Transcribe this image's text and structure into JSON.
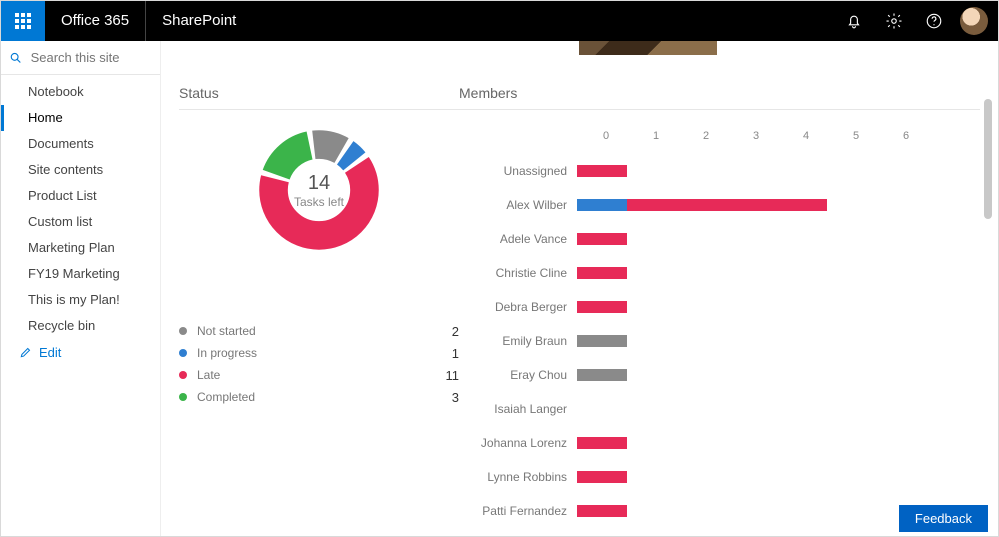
{
  "header": {
    "brand": "Office 365",
    "app": "SharePoint"
  },
  "search": {
    "placeholder": "Search this site"
  },
  "nav": {
    "items": [
      {
        "label": "Notebook",
        "selected": false
      },
      {
        "label": "Home",
        "selected": true
      },
      {
        "label": "Documents",
        "selected": false
      },
      {
        "label": "Site contents",
        "selected": false
      },
      {
        "label": "Product List",
        "selected": false
      },
      {
        "label": "Custom list",
        "selected": false
      },
      {
        "label": "Marketing Plan",
        "selected": false
      },
      {
        "label": "FY19 Marketing",
        "selected": false
      },
      {
        "label": "This is my Plan!",
        "selected": false
      },
      {
        "label": "Recycle bin",
        "selected": false
      }
    ],
    "edit": "Edit"
  },
  "status": {
    "title": "Status",
    "center_number": "14",
    "center_label": "Tasks left",
    "legend": [
      {
        "label": "Not started",
        "value": 2,
        "color": "#8a8a8a"
      },
      {
        "label": "In progress",
        "value": 1,
        "color": "#2f7fd1"
      },
      {
        "label": "Late",
        "value": 11,
        "color": "#e72a58"
      },
      {
        "label": "Completed",
        "value": 3,
        "color": "#3bb44a"
      }
    ]
  },
  "members": {
    "title": "Members",
    "axis": [
      0,
      1,
      2,
      3,
      4,
      5,
      6
    ],
    "rows": [
      {
        "name": "Unassigned",
        "segments": [
          {
            "color": "#e72a58",
            "value": 1
          }
        ]
      },
      {
        "name": "Alex Wilber",
        "segments": [
          {
            "color": "#2f7fd1",
            "value": 1
          },
          {
            "color": "#e72a58",
            "value": 4
          }
        ]
      },
      {
        "name": "Adele Vance",
        "segments": [
          {
            "color": "#e72a58",
            "value": 1
          }
        ]
      },
      {
        "name": "Christie Cline",
        "segments": [
          {
            "color": "#e72a58",
            "value": 1
          }
        ]
      },
      {
        "name": "Debra Berger",
        "segments": [
          {
            "color": "#e72a58",
            "value": 1
          }
        ]
      },
      {
        "name": "Emily Braun",
        "segments": [
          {
            "color": "#8a8a8a",
            "value": 1
          }
        ]
      },
      {
        "name": "Eray Chou",
        "segments": [
          {
            "color": "#8a8a8a",
            "value": 1
          }
        ]
      },
      {
        "name": "Isaiah Langer",
        "segments": []
      },
      {
        "name": "Johanna Lorenz",
        "segments": [
          {
            "color": "#e72a58",
            "value": 1
          }
        ]
      },
      {
        "name": "Lynne Robbins",
        "segments": [
          {
            "color": "#e72a58",
            "value": 1
          }
        ]
      },
      {
        "name": "Patti Fernandez",
        "segments": [
          {
            "color": "#e72a58",
            "value": 1
          }
        ]
      }
    ]
  },
  "feedback": {
    "label": "Feedback"
  },
  "chart_data": [
    {
      "type": "pie",
      "title": "Status",
      "center_label": "14 Tasks left",
      "series": [
        {
          "name": "Not started",
          "value": 2
        },
        {
          "name": "In progress",
          "value": 1
        },
        {
          "name": "Late",
          "value": 11
        },
        {
          "name": "Completed",
          "value": 3
        }
      ]
    },
    {
      "type": "bar",
      "title": "Members",
      "xlabel": "",
      "ylabel": "",
      "xlim": [
        0,
        6
      ],
      "categories": [
        "Unassigned",
        "Alex Wilber",
        "Adele Vance",
        "Christie Cline",
        "Debra Berger",
        "Emily Braun",
        "Eray Chou",
        "Isaiah Langer",
        "Johanna Lorenz",
        "Lynne Robbins",
        "Patti Fernandez"
      ],
      "series": [
        {
          "name": "Not started",
          "values": [
            0,
            0,
            0,
            0,
            0,
            1,
            1,
            0,
            0,
            0,
            0
          ]
        },
        {
          "name": "In progress",
          "values": [
            0,
            1,
            0,
            0,
            0,
            0,
            0,
            0,
            0,
            0,
            0
          ]
        },
        {
          "name": "Late",
          "values": [
            1,
            4,
            1,
            1,
            1,
            0,
            0,
            0,
            1,
            1,
            1
          ]
        },
        {
          "name": "Completed",
          "values": [
            0,
            0,
            0,
            0,
            0,
            0,
            0,
            0,
            0,
            0,
            0
          ]
        }
      ]
    }
  ]
}
